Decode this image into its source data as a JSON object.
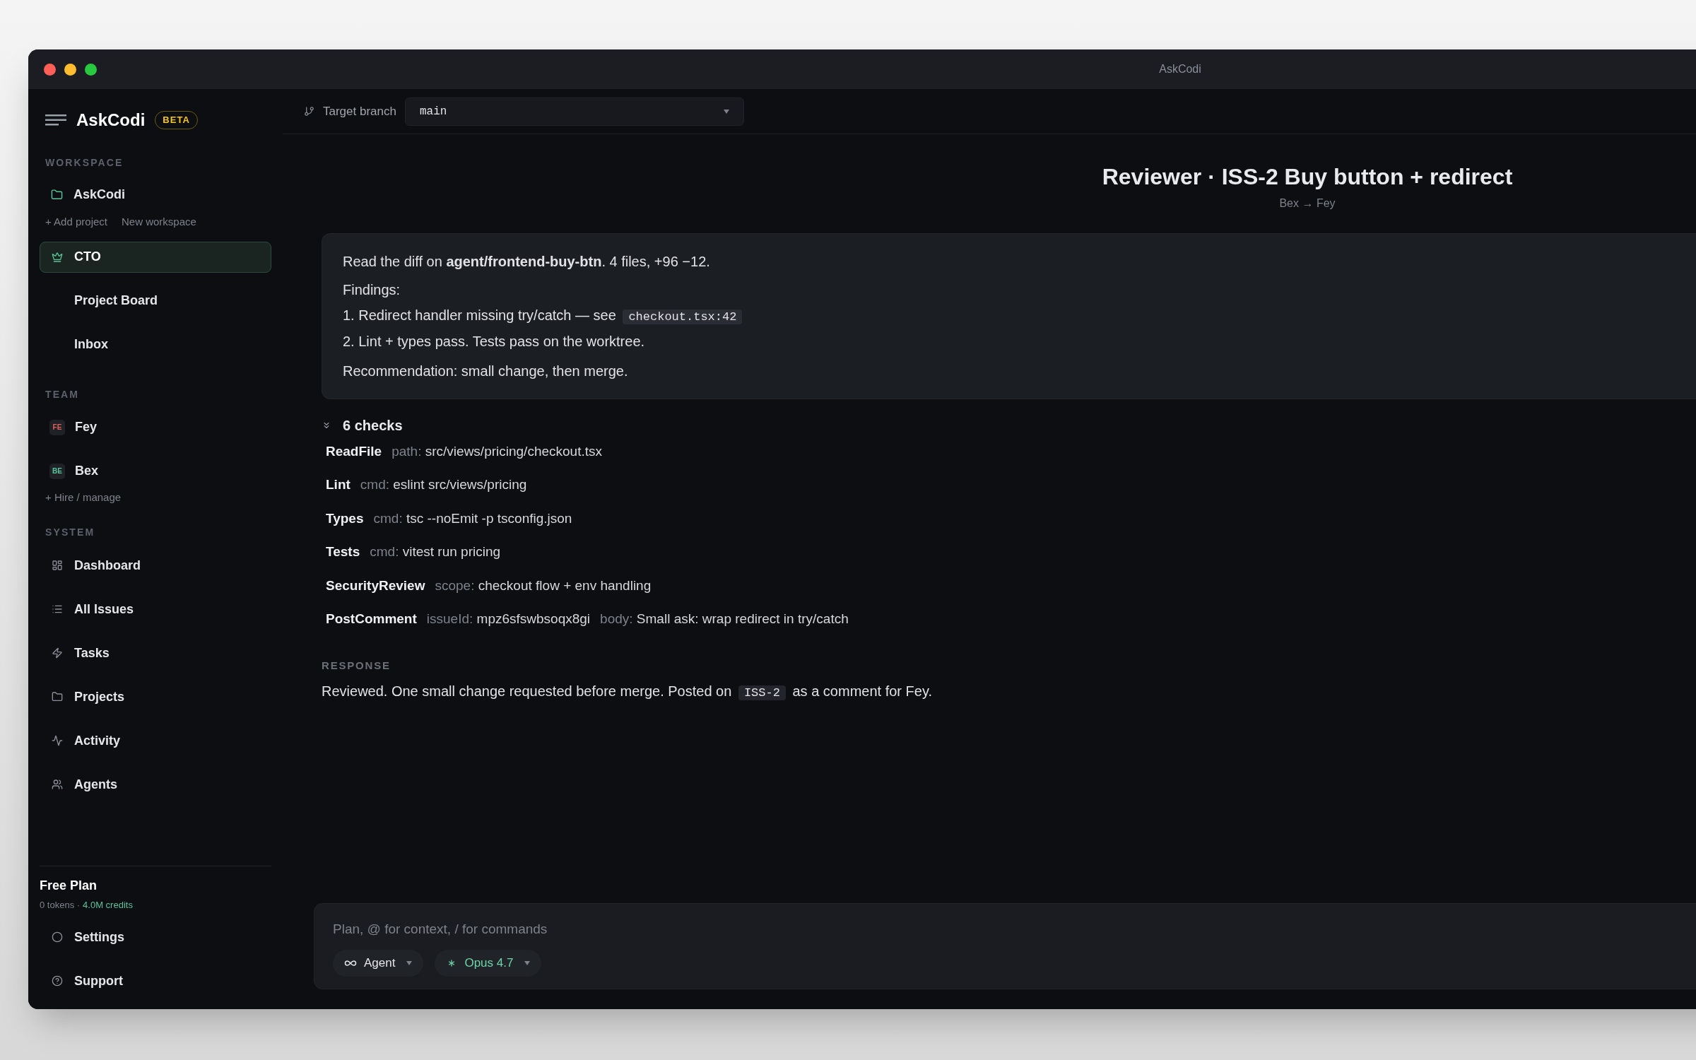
{
  "window": {
    "title": "AskCodi"
  },
  "sidebar": {
    "brand": "AskCodi",
    "badge": "BETA",
    "workspace_heading": "WORKSPACE",
    "workspace": {
      "name": "AskCodi"
    },
    "workspace_links": [
      "+ Add project",
      "New workspace"
    ],
    "nav": [
      {
        "label": "CTO",
        "selected": true
      },
      {
        "label": "Project Board",
        "selected": false
      },
      {
        "label": "Inbox",
        "selected": false
      }
    ],
    "team_heading": "TEAM",
    "team": [
      {
        "initials": "FE",
        "name": "Fey",
        "color": "#e0605a"
      },
      {
        "initials": "BE",
        "name": "Bex",
        "color": "#5cc39a"
      }
    ],
    "team_link": "+ Hire / manage",
    "system_heading": "SYSTEM",
    "system": [
      {
        "label": "Dashboard"
      },
      {
        "label": "All Issues"
      },
      {
        "label": "Tasks"
      },
      {
        "label": "Projects"
      },
      {
        "label": "Activity"
      },
      {
        "label": "Agents"
      }
    ],
    "plan": {
      "title": "Free Plan",
      "tokens": "0 tokens ·",
      "credits": "4.0M credits"
    },
    "footer": [
      {
        "label": "Settings"
      },
      {
        "label": "Support"
      }
    ]
  },
  "toolbar": {
    "label": "Target branch",
    "branch": "main"
  },
  "header": {
    "title": "Reviewer · ISS-2 Buy button + redirect",
    "subtitle": "Bex → Fey"
  },
  "message": {
    "intro": "Read the diff on **agent/frontend-buy-btn**. 4 files, +96 −12.",
    "findings_label": "Findings:",
    "findings": [
      {
        "text": "1. Redirect handler missing try/catch — see",
        "code": "checkout.tsx:42"
      },
      {
        "text": "2. Lint + types pass. Tests pass on the worktree."
      }
    ],
    "recommendation": "Recommendation: small change, then merge."
  },
  "checks": {
    "summary": "6 checks",
    "expanded": true,
    "items": [
      {
        "name": "ReadFile",
        "params": [
          {
            "key": "path:",
            "value": "src/views/pricing/checkout.tsx"
          }
        ]
      },
      {
        "name": "Lint",
        "params": [
          {
            "key": "cmd:",
            "value": "eslint src/views/pricing"
          }
        ]
      },
      {
        "name": "Types",
        "params": [
          {
            "key": "cmd:",
            "value": "tsc --noEmit -p tsconfig.json"
          }
        ]
      },
      {
        "name": "Tests",
        "params": [
          {
            "key": "cmd:",
            "value": "vitest run pricing"
          }
        ]
      },
      {
        "name": "SecurityReview",
        "params": [
          {
            "key": "scope:",
            "value": "checkout flow + env handling"
          }
        ]
      },
      {
        "name": "PostComment",
        "params": [
          {
            "key": "issueId:",
            "value": "mpz6sfswbsoqx8gi"
          },
          {
            "key": "body:",
            "value": "Small ask: wrap redirect in try/catch"
          }
        ]
      }
    ]
  },
  "response": {
    "heading": "RESPONSE",
    "before": "Reviewed. One small change requested before merge. Posted on",
    "code": "ISS-2",
    "after": "as a comment for Fey."
  },
  "composer": {
    "placeholder": "Plan, @ for context, / for commands",
    "chips": [
      {
        "kind": "mode",
        "label": "Agent"
      },
      {
        "kind": "model",
        "label": "Opus 4.7"
      }
    ]
  }
}
